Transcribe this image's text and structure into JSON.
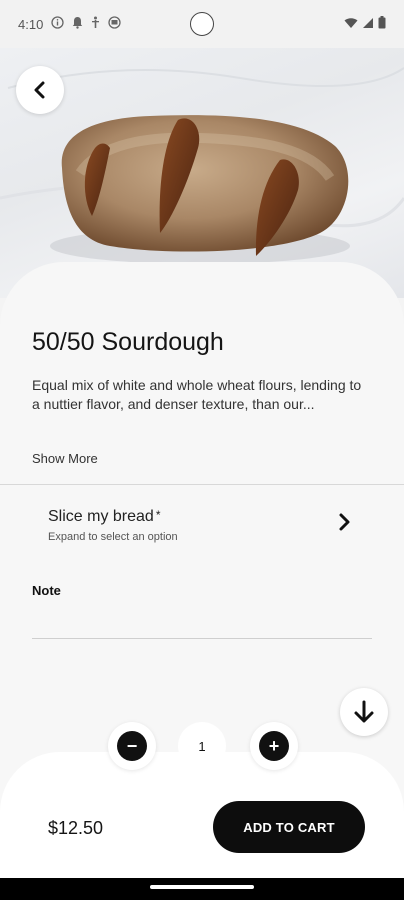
{
  "status_bar": {
    "time": "4:10",
    "icons": [
      "info-icon",
      "notification-icon",
      "accessibility-icon",
      "app-icon"
    ],
    "right_icons": [
      "wifi-icon",
      "signal-icon",
      "battery-icon"
    ]
  },
  "product": {
    "name": "50/50 Sourdough",
    "description": "Equal mix of white and whole wheat flours, lending to a nuttier flavor, and denser texture, than our...",
    "show_more_label": "Show More"
  },
  "options": {
    "slice_title": "Slice my bread",
    "required_marker": "*",
    "slice_subtitle": "Expand to select an option"
  },
  "note": {
    "label": "Note",
    "value": ""
  },
  "quantity": {
    "value": "1",
    "decrement": "−",
    "increment": "+"
  },
  "cart": {
    "price": "$12.50",
    "button_label": "ADD TO CART"
  },
  "colors": {
    "accent": "#0d0d0d",
    "sheet_bg": "#f7f7f7",
    "bread_crust": "#a98766"
  }
}
